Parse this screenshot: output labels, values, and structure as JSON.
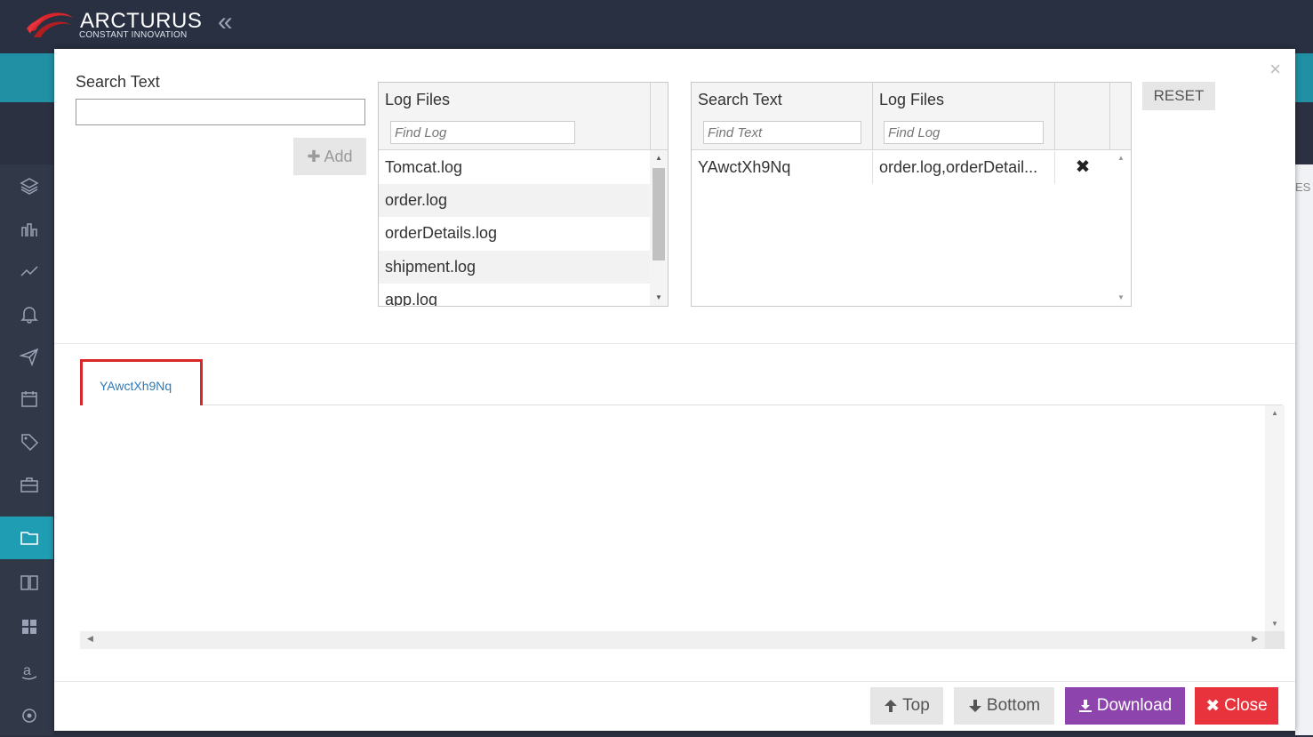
{
  "app": {
    "brand_name": "ARCTURUS",
    "brand_tagline": "CONSTANT INNOVATION",
    "collapse_glyph": "«",
    "right_strip_text": "ES"
  },
  "sidebar": {
    "items": [
      {
        "icon": "layers-icon"
      },
      {
        "icon": "bar-chart-icon"
      },
      {
        "icon": "line-chart-icon"
      },
      {
        "icon": "bell-icon"
      },
      {
        "icon": "paper-plane-icon"
      },
      {
        "icon": "calendar-icon"
      },
      {
        "icon": "tag-icon"
      },
      {
        "icon": "briefcase-icon"
      },
      {
        "icon": "folder-icon",
        "active": true
      },
      {
        "icon": "book-icon"
      },
      {
        "icon": "grid-icon"
      },
      {
        "icon": "amazon-icon"
      },
      {
        "icon": "settings-icon"
      }
    ]
  },
  "modal": {
    "close_glyph": "×",
    "search": {
      "label": "Search Text",
      "value": "",
      "add_label": "Add"
    },
    "log_files_grid": {
      "header": "Log Files",
      "filter_placeholder": "Find Log",
      "rows": [
        "Tomcat.log",
        "order.log",
        "orderDetails.log",
        "shipment.log",
        "app.log"
      ]
    },
    "saved_grid": {
      "col_search_header": "Search Text",
      "col_logs_header": "Log Files",
      "search_filter_placeholder": "Find Text",
      "logs_filter_placeholder": "Find Log",
      "rows": [
        {
          "search_text": "YAwctXh9Nq",
          "log_files": "order.log,orderDetail..."
        }
      ]
    },
    "reset_label": "RESET",
    "result_tab_label": "YAwctXh9Nq",
    "footer": {
      "top_label": "Top",
      "bottom_label": "Bottom",
      "download_label": "Download",
      "close_label": "Close"
    }
  },
  "colors": {
    "topbar": "#283042",
    "teal": "#2190a4",
    "download": "#8e44ad",
    "close": "#e8323c",
    "tab_highlight": "#d9262b",
    "link": "#2f7ab8"
  }
}
